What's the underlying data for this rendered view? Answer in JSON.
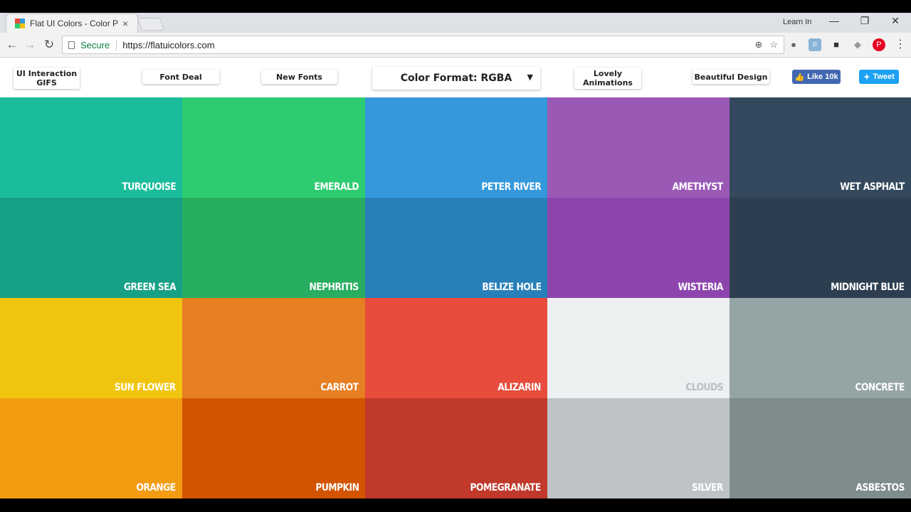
{
  "browser": {
    "tab_title": "Flat UI Colors - Color Pal",
    "tab_close": "×",
    "user_label": "Learn In",
    "win_min": "—",
    "win_restore": "❐",
    "win_close": "✕",
    "back": "←",
    "forward": "→",
    "reload": "↻",
    "secure_label": "Secure",
    "url": "https://flatuicolors.com",
    "menu": "⋮"
  },
  "nav": {
    "ui_interaction": "UI Interaction GIFS",
    "font_deal": "Font Deal",
    "new_fonts": "New Fonts",
    "color_format": "Color Format: RGBA",
    "lovely_animations": "Lovely Animations",
    "beautiful_design": "Beautiful Design",
    "fb_like": "Like 10k",
    "tweet": "Tweet"
  },
  "swatches": [
    {
      "name": "TURQUOISE",
      "color": "#1abc9c"
    },
    {
      "name": "EMERALD",
      "color": "#2ecc71"
    },
    {
      "name": "PETER RIVER",
      "color": "#3498db"
    },
    {
      "name": "AMETHYST",
      "color": "#9b59b6"
    },
    {
      "name": "WET ASPHALT",
      "color": "#34495e"
    },
    {
      "name": "GREEN SEA",
      "color": "#16a085"
    },
    {
      "name": "NEPHRITIS",
      "color": "#27ae60"
    },
    {
      "name": "BELIZE HOLE",
      "color": "#2980b9"
    },
    {
      "name": "WISTERIA",
      "color": "#8e44ad"
    },
    {
      "name": "MIDNIGHT BLUE",
      "color": "#2c3e50"
    },
    {
      "name": "SUN FLOWER",
      "color": "#f1c40f"
    },
    {
      "name": "CARROT",
      "color": "#e67e22"
    },
    {
      "name": "ALIZARIN",
      "color": "#e74c3c"
    },
    {
      "name": "CLOUDS",
      "color": "#ecf0f1"
    },
    {
      "name": "CONCRETE",
      "color": "#95a5a6"
    },
    {
      "name": "ORANGE",
      "color": "#f39c12"
    },
    {
      "name": "PUMPKIN",
      "color": "#d35400"
    },
    {
      "name": "POMEGRANATE",
      "color": "#c0392b"
    },
    {
      "name": "SILVER",
      "color": "#bdc3c7"
    },
    {
      "name": "ASBESTOS",
      "color": "#7f8c8d"
    }
  ]
}
